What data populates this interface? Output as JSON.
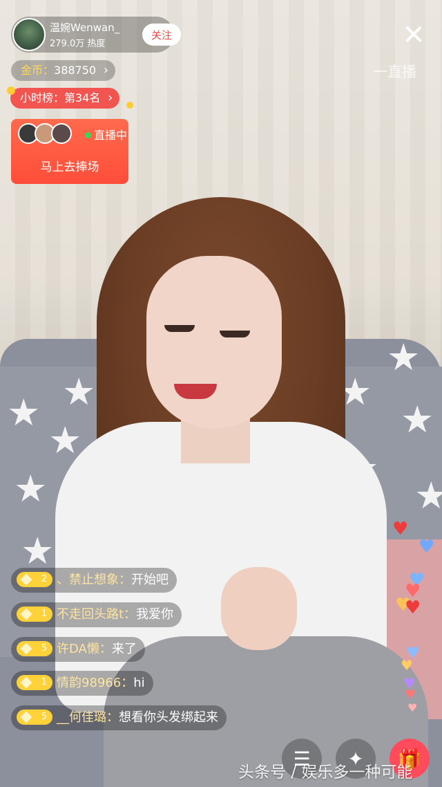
{
  "anchor": {
    "name": "温婉Wenwan_",
    "heat": "279.0万 热度",
    "follow_label": "关注"
  },
  "close_icon": "close-icon",
  "platform_watermark": "一直播",
  "coins": {
    "label": "金币：",
    "value": "388750"
  },
  "hourly_rank": {
    "label": "小时榜：第34名"
  },
  "live_card": {
    "status": "直播中",
    "cta": "马上去捧场"
  },
  "chat": [
    {
      "level": "2",
      "user": "、禁止想象：",
      "message": "开始吧"
    },
    {
      "level": "1",
      "user": "不走回头路t：",
      "message": "我爱你"
    },
    {
      "level": "5",
      "user": "许DA懒：",
      "message": "来了"
    },
    {
      "level": "1",
      "user": "情韵98966：",
      "message": "hi"
    },
    {
      "level": "5",
      "user": "__何佳璐：",
      "message": "想看你头发绑起来"
    }
  ],
  "bottom_watermark": "头条号 / 娱乐多一种可能",
  "colors": {
    "accent_red": "#f25450",
    "follow_text": "#e84a4a",
    "badge_gold": "#ffd23a",
    "live_green": "#3dd45a"
  }
}
